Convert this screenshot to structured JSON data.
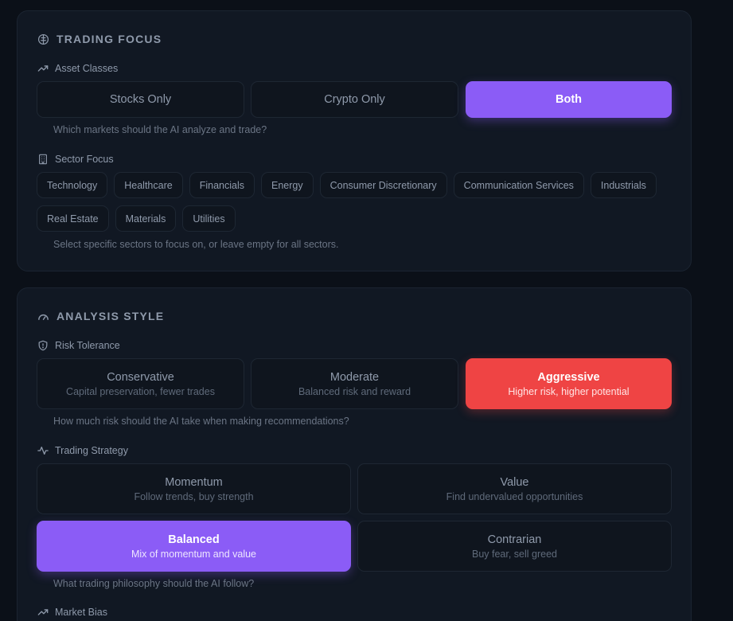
{
  "trading_focus": {
    "title": "TRADING FOCUS",
    "asset_classes": {
      "label": "Asset Classes",
      "options": [
        "Stocks Only",
        "Crypto Only",
        "Both"
      ],
      "selected": "Both",
      "hint": "Which markets should the AI analyze and trade?"
    },
    "sector_focus": {
      "label": "Sector Focus",
      "sectors": [
        "Technology",
        "Healthcare",
        "Financials",
        "Energy",
        "Consumer Discretionary",
        "Communication Services",
        "Industrials",
        "Real Estate",
        "Materials",
        "Utilities"
      ],
      "hint": "Select specific sectors to focus on, or leave empty for all sectors."
    }
  },
  "analysis_style": {
    "title": "ANALYSIS STYLE",
    "risk_tolerance": {
      "label": "Risk Tolerance",
      "options": [
        {
          "title": "Conservative",
          "subtitle": "Capital preservation, fewer trades"
        },
        {
          "title": "Moderate",
          "subtitle": "Balanced risk and reward"
        },
        {
          "title": "Aggressive",
          "subtitle": "Higher risk, higher potential"
        }
      ],
      "selected": "Aggressive",
      "hint": "How much risk should the AI take when making recommendations?"
    },
    "trading_strategy": {
      "label": "Trading Strategy",
      "options": [
        {
          "title": "Momentum",
          "subtitle": "Follow trends, buy strength"
        },
        {
          "title": "Value",
          "subtitle": "Find undervalued opportunities"
        },
        {
          "title": "Balanced",
          "subtitle": "Mix of momentum and value"
        },
        {
          "title": "Contrarian",
          "subtitle": "Buy fear, sell greed"
        }
      ],
      "selected": "Balanced",
      "hint": "What trading philosophy should the AI follow?"
    },
    "market_bias": {
      "label": "Market Bias"
    }
  },
  "colors": {
    "accent_purple": "#8b5cf6",
    "accent_red": "#ef4444",
    "background": "#0b1018",
    "card": "#111823"
  },
  "icons": {
    "trading_focus": "brain-icon",
    "asset_classes": "trending-up-icon",
    "sector_focus": "building-icon",
    "analysis_style": "gauge-icon",
    "risk_tolerance": "shield-icon",
    "trading_strategy": "activity-icon",
    "market_bias": "trending-up-icon"
  }
}
